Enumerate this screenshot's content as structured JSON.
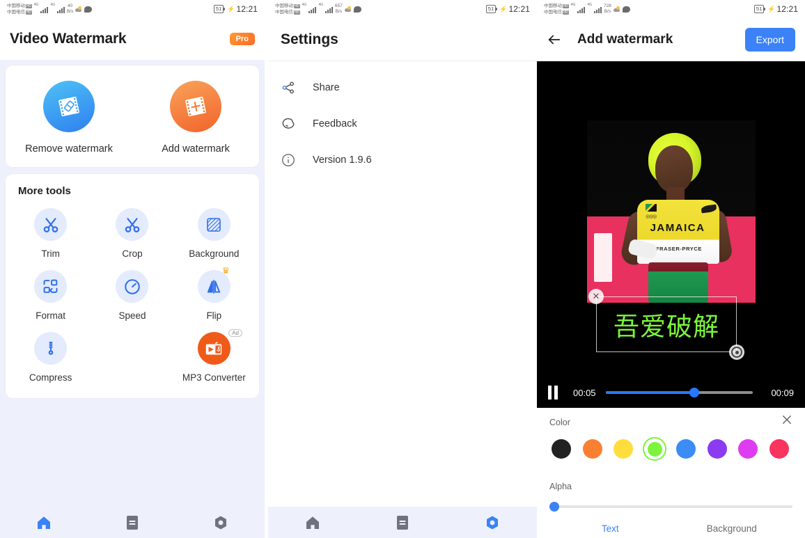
{
  "statusbar": {
    "carrier_line1": "中国移动",
    "carrier_line2": "中国电信",
    "hd_badge": "HD",
    "net_type": "4G",
    "speed_panel1": "40",
    "speed_panel2": "657",
    "speed_panel3": "728",
    "speed_unit": "B/s",
    "battery": "51",
    "time": "12:21"
  },
  "panel1": {
    "title": "Video Watermark",
    "pro_badge": "Pro",
    "main_actions": [
      {
        "label": "Remove watermark",
        "icon": "remove-watermark-icon"
      },
      {
        "label": "Add watermark",
        "icon": "add-watermark-icon"
      }
    ],
    "more_tools_title": "More tools",
    "tools": [
      {
        "label": "Trim",
        "icon": "scissors-icon",
        "badge": ""
      },
      {
        "label": "Crop",
        "icon": "scissors-icon",
        "badge": ""
      },
      {
        "label": "Background",
        "icon": "hatch-square-icon",
        "badge": ""
      },
      {
        "label": "Format",
        "icon": "format-shapes-icon",
        "badge": ""
      },
      {
        "label": "Speed",
        "icon": "speedometer-icon",
        "badge": ""
      },
      {
        "label": "Flip",
        "icon": "flip-icon",
        "badge": "crown"
      },
      {
        "label": "Compress",
        "icon": "compress-icon",
        "badge": ""
      },
      {
        "label": "",
        "icon": "",
        "badge": ""
      },
      {
        "label": "MP3 Converter",
        "icon": "mp3-converter-icon",
        "badge": "Ad"
      }
    ],
    "nav": [
      {
        "name": "home",
        "icon": "home-icon",
        "active": true
      },
      {
        "name": "files",
        "icon": "files-icon",
        "active": false
      },
      {
        "name": "settings",
        "icon": "gear-icon",
        "active": false
      }
    ]
  },
  "panel2": {
    "title": "Settings",
    "items": [
      {
        "label": "Share",
        "icon": "share-icon"
      },
      {
        "label": "Feedback",
        "icon": "feedback-icon"
      },
      {
        "label": "Version 1.9.6",
        "icon": "info-icon"
      }
    ],
    "nav": [
      {
        "name": "home",
        "icon": "home-icon",
        "active": false
      },
      {
        "name": "files",
        "icon": "files-icon",
        "active": false
      },
      {
        "name": "settings",
        "icon": "gear-icon",
        "active": true
      }
    ]
  },
  "panel3": {
    "title": "Add watermark",
    "back_icon": "back-arrow-icon",
    "export_label": "Export",
    "video": {
      "jersey_country": "JAMAICA",
      "jersey_name": "FRASER-PRYCE",
      "watermark_text": "吾爱破解",
      "watermark_color": "#7CF43C",
      "current_time": "00:05",
      "total_time": "00:09",
      "progress_percent": 60,
      "play_state": "paused"
    },
    "editor": {
      "color_label": "Color",
      "alpha_label": "Alpha",
      "alpha_value": 0,
      "close_icon": "close-icon",
      "swatches": [
        {
          "name": "black",
          "hex": "#222222",
          "selected": false
        },
        {
          "name": "orange",
          "hex": "#F98032",
          "selected": false
        },
        {
          "name": "yellow",
          "hex": "#FEDE3C",
          "selected": false
        },
        {
          "name": "green",
          "hex": "#7CF43C",
          "selected": true
        },
        {
          "name": "blue",
          "hex": "#3B8CF5",
          "selected": false
        },
        {
          "name": "purple",
          "hex": "#8B3CF0",
          "selected": false
        },
        {
          "name": "magenta",
          "hex": "#DD3CF0",
          "selected": false
        },
        {
          "name": "pink",
          "hex": "#F9345E",
          "selected": false
        }
      ],
      "tabs": [
        {
          "label": "Text",
          "active": true
        },
        {
          "label": "Background",
          "active": false
        }
      ]
    }
  }
}
